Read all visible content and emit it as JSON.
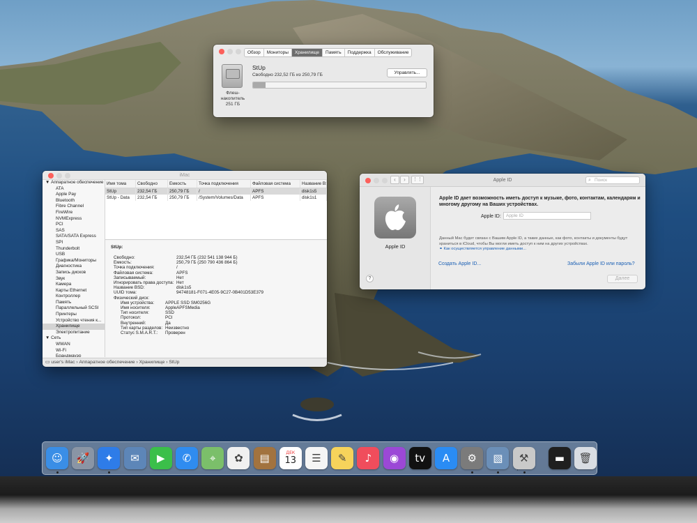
{
  "storage_window": {
    "tabs": [
      {
        "label": "Обзор",
        "active": false
      },
      {
        "label": "Мониторы",
        "active": false
      },
      {
        "label": "Хранилище",
        "active": true
      },
      {
        "label": "Память",
        "active": false
      },
      {
        "label": "Поддержка",
        "active": false
      },
      {
        "label": "Обслуживание",
        "active": false
      }
    ],
    "disk_label_line1": "Флеш-",
    "disk_label_line2": "накопитель",
    "disk_label_line3": "251 ГБ",
    "volume_name": "StUp",
    "volume_free": "Свободно 232,52 ГБ из 250,79 ГБ",
    "manage_button": "Управлять...",
    "used_fraction": 0.073
  },
  "sysinfo_window": {
    "title": "iMac",
    "sidebar": [
      {
        "label": "Аппаратное обеспечение",
        "group": true
      },
      {
        "label": "ATA"
      },
      {
        "label": "Apple Pay"
      },
      {
        "label": "Bluetooth"
      },
      {
        "label": "Fibre Channel"
      },
      {
        "label": "FireWire"
      },
      {
        "label": "NVMExpress"
      },
      {
        "label": "PCI"
      },
      {
        "label": "SAS"
      },
      {
        "label": "SATA/SATA Express"
      },
      {
        "label": "SPI"
      },
      {
        "label": "Thunderbolt"
      },
      {
        "label": "USB"
      },
      {
        "label": "Графика/Мониторы"
      },
      {
        "label": "Диагностика"
      },
      {
        "label": "Запись дисков"
      },
      {
        "label": "Звук"
      },
      {
        "label": "Камера"
      },
      {
        "label": "Карты Ethernet"
      },
      {
        "label": "Контроллер"
      },
      {
        "label": "Память"
      },
      {
        "label": "Параллельный SCSI"
      },
      {
        "label": "Принтеры"
      },
      {
        "label": "Устройство чтения к..."
      },
      {
        "label": "Хранилище",
        "selected": true
      },
      {
        "label": "Электропитание"
      },
      {
        "label": "Сеть",
        "group": true
      },
      {
        "label": "WWAN"
      },
      {
        "label": "Wi-Fi"
      },
      {
        "label": "Брандмауэр"
      }
    ],
    "table": {
      "headers": [
        "Имя тома",
        "Свободно",
        "Емкость",
        "Точка подключения",
        "Файловая система",
        "Название BSD"
      ],
      "rows": [
        [
          "StUp",
          "232,54 ГБ",
          "250,79 ГБ",
          "/",
          "APFS",
          "disk1s5"
        ],
        [
          "StUp - Data",
          "232,54 ГБ",
          "250,79 ГБ",
          "/System/Volumes/Data",
          "APFS",
          "disk1s1"
        ]
      ]
    },
    "detail_title": "StUp:",
    "detail": [
      {
        "k": "Свободно:",
        "v": "232,54 ГБ (232 541 138 944 Б)"
      },
      {
        "k": "Емкость:",
        "v": "250,79 ГБ (250 790 436 864 Б)"
      },
      {
        "k": "Точка подключения:",
        "v": "/"
      },
      {
        "k": "Файловая система:",
        "v": "APFS"
      },
      {
        "k": "Записываемый:",
        "v": "Нет"
      },
      {
        "k": "Игнорировать права доступа:",
        "v": "Нет"
      },
      {
        "k": "Название BSD:",
        "v": "disk1s5"
      },
      {
        "k": "UUID тома:",
        "v": "94748181-F071-4E05-9C27-0B401D53E379"
      },
      {
        "k": "Физический диск:",
        "v": ""
      }
    ],
    "detail_physical": [
      {
        "k": "Имя устройства:",
        "v": "APPLE SSD SM0256G"
      },
      {
        "k": "Имя носителя:",
        "v": "AppleAPFSMedia"
      },
      {
        "k": "Тип носителя:",
        "v": "SSD"
      },
      {
        "k": "Протокол:",
        "v": "PCI"
      },
      {
        "k": "Внутренний:",
        "v": "Да"
      },
      {
        "k": "Тип карты разделов:",
        "v": "Неизвестно"
      },
      {
        "k": "Статус S.M.A.R.T.:",
        "v": "Проверен"
      }
    ],
    "breadcrumb": "user's iMac › Аппаратное обеспечение › Хранилище › StUp"
  },
  "appleid_window": {
    "title": "Apple ID",
    "search_placeholder": "Поиск",
    "left_label": "Apple ID",
    "description": "Apple ID дает возможность иметь доступ к музыке, фото, контактам, календарям и многому другому на Ваших устройствах.",
    "field_label": "Apple ID:",
    "field_placeholder": "Apple ID",
    "note": "Данный Mac будет связан с Вашим Apple ID, а такие данные, как фото, контакты и документы будут храниться в iCloud, чтобы Вы могли иметь доступ к ним на других устройствах.",
    "note_link": "Как осуществляется управление данными...",
    "create_link": "Создать Apple ID...",
    "forgot_link": "Забыли Apple ID или пароль?",
    "next_button": "Далее",
    "help": "?"
  },
  "dock": {
    "apps": [
      {
        "name": "finder-icon",
        "color": "#3a8ee6",
        "glyph": "☺",
        "running": true
      },
      {
        "name": "launchpad-icon",
        "color": "#8a95a5",
        "glyph": "🚀",
        "running": false
      },
      {
        "name": "safari-icon",
        "color": "#2e7ce8",
        "glyph": "✦",
        "running": true
      },
      {
        "name": "mail-stamp-icon",
        "color": "#5d86b8",
        "glyph": "✉",
        "running": false
      },
      {
        "name": "facetime-icon",
        "color": "#3bbf4a",
        "glyph": "▶",
        "running": false
      },
      {
        "name": "messages-icon",
        "color": "#2f8cf0",
        "glyph": "✆",
        "running": false
      },
      {
        "name": "maps-icon",
        "color": "#7bbf6a",
        "glyph": "⌖",
        "running": false
      },
      {
        "name": "photos-icon",
        "color": "#f0f0f0",
        "glyph": "✿",
        "running": false
      },
      {
        "name": "notes-book-icon",
        "color": "#a2733f",
        "glyph": "▤",
        "running": false
      },
      {
        "name": "calendar-icon",
        "color": "#ffffff",
        "glyph": "13",
        "running": false
      },
      {
        "name": "reminders-icon",
        "color": "#f5f5f5",
        "glyph": "☰",
        "running": false
      },
      {
        "name": "notes-icon",
        "color": "#f6d35b",
        "glyph": "✎",
        "running": false
      },
      {
        "name": "music-icon",
        "color": "#f04d5c",
        "glyph": "♪",
        "running": false
      },
      {
        "name": "podcasts-icon",
        "color": "#9b48d6",
        "glyph": "◉",
        "running": false
      },
      {
        "name": "tv-icon",
        "color": "#111111",
        "glyph": "tv",
        "running": false
      },
      {
        "name": "app-store-icon",
        "color": "#2a8cf4",
        "glyph": "A",
        "running": false
      },
      {
        "name": "system-preferences-icon",
        "color": "#7b7b7b",
        "glyph": "⚙",
        "running": true
      },
      {
        "name": "preview-icon",
        "color": "#6b8fb8",
        "glyph": "▧",
        "running": true
      },
      {
        "name": "system-information-icon",
        "color": "#c9c9c9",
        "glyph": "⚒",
        "running": true
      },
      {
        "name": "downloads-folder-icon",
        "color": "#1f1f1f",
        "glyph": "▬",
        "running": false
      },
      {
        "name": "trash-icon",
        "color": "#d9dde3",
        "glyph": "🗑",
        "running": false
      }
    ],
    "calendar_month": "ДЕК"
  }
}
